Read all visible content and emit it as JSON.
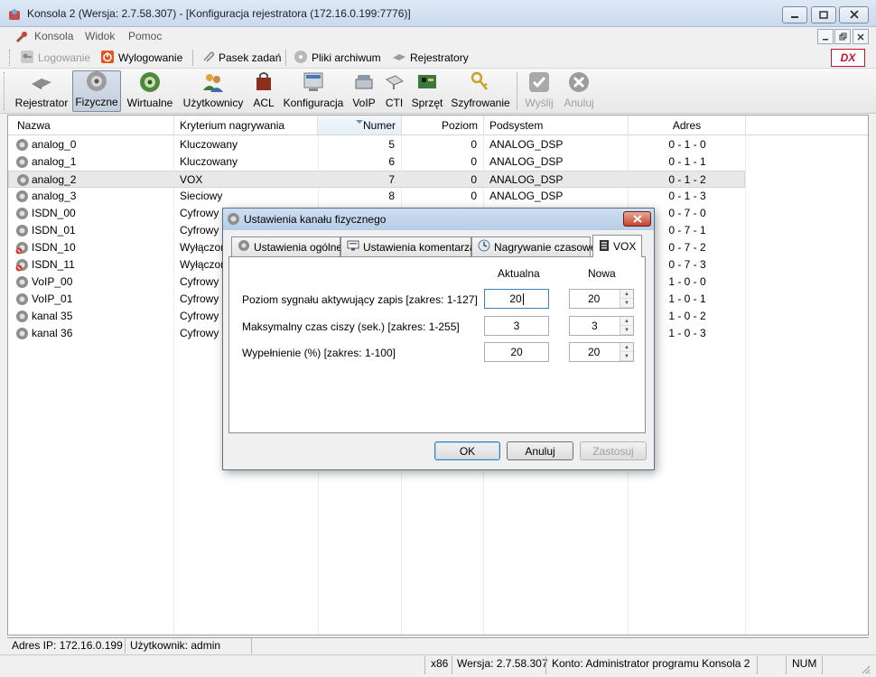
{
  "window": {
    "title": "Konsola 2 (Wersja:  2.7.58.307) - [Konfiguracja rejestratora (172.16.0.199:7776)]"
  },
  "menu": [
    "Konsola",
    "Widok",
    "Pomoc"
  ],
  "toolbar1": {
    "login": "Logowanie",
    "logout": "Wylogowanie",
    "taskbar": "Pasek zadań",
    "archives": "Pliki archiwum",
    "recorders": "Rejestratory",
    "brand": "DX"
  },
  "toolbar2": {
    "items": [
      "Rejestrator",
      "Fizyczne",
      "Wirtualne",
      "Użytkownicy",
      "ACL",
      "Konfiguracja",
      "VoIP",
      "CTI",
      "Sprzęt",
      "Szyfrowanie"
    ],
    "send": "Wyślij",
    "cancel": "Anuluj"
  },
  "list": {
    "columns": [
      "Nazwa",
      "Kryterium nagrywania",
      "Numer",
      "Poziom",
      "Podsystem",
      "Adres"
    ],
    "rows": [
      {
        "name": "analog_0",
        "criterion": "Kluczowany",
        "number": "5",
        "level": "0",
        "subsystem": "ANALOG_DSP",
        "address": "0 - 1 - 0"
      },
      {
        "name": "analog_1",
        "criterion": "Kluczowany",
        "number": "6",
        "level": "0",
        "subsystem": "ANALOG_DSP",
        "address": "0 - 1 - 1"
      },
      {
        "name": "analog_2",
        "criterion": "VOX",
        "number": "7",
        "level": "0",
        "subsystem": "ANALOG_DSP",
        "address": "0 - 1 - 2"
      },
      {
        "name": "analog_3",
        "criterion": "Sieciowy",
        "number": "8",
        "level": "0",
        "subsystem": "ANALOG_DSP",
        "address": "0 - 1 - 3"
      },
      {
        "name": "ISDN_00",
        "criterion": "Cyfrowy",
        "address": "0 - 7 - 0"
      },
      {
        "name": "ISDN_01",
        "criterion": "Cyfrowy",
        "address": "0 - 7 - 1"
      },
      {
        "name": "ISDN_10",
        "criterion": "Wyłączon",
        "address": "0 - 7 - 2"
      },
      {
        "name": "ISDN_11",
        "criterion": "Wyłączon",
        "address": "0 - 7 - 3"
      },
      {
        "name": "VoIP_00",
        "criterion": "Cyfrowy",
        "address": "1 - 0 - 0"
      },
      {
        "name": "VoIP_01",
        "criterion": "Cyfrowy",
        "address": "1 - 0 - 1"
      },
      {
        "name": "kanal 35",
        "criterion": "Cyfrowy",
        "address": "1 - 0 - 2"
      },
      {
        "name": "kanal 36",
        "criterion": "Cyfrowy",
        "address": "1 - 0 - 3"
      }
    ]
  },
  "status": {
    "ip": "Adres IP: 172.16.0.199",
    "user": "Użytkownik: admin",
    "arch": "x86",
    "version": "Wersja: 2.7.58.307",
    "account": "Konto: Administrator programu Konsola 2",
    "num": "NUM"
  },
  "dialog": {
    "title": "Ustawienia kanału fizycznego",
    "tabs": [
      "Ustawienia ogólne",
      "Ustawienia komentarza",
      "Nagrywanie czasowe",
      "VOX"
    ],
    "col_current": "Aktualna",
    "col_new": "Nowa",
    "fields": [
      {
        "label": "Poziom sygnału aktywujący zapis [zakres: 1-127]",
        "current": "20",
        "new": "20"
      },
      {
        "label": "Maksymalny czas ciszy (sek.) [zakres: 1-255]",
        "current": "3",
        "new": "3"
      },
      {
        "label": "Wypełnienie (%) [zakres: 1-100]",
        "current": "20",
        "new": "20"
      }
    ],
    "ok": "OK",
    "cancel": "Anuluj",
    "apply": "Zastosuj"
  }
}
